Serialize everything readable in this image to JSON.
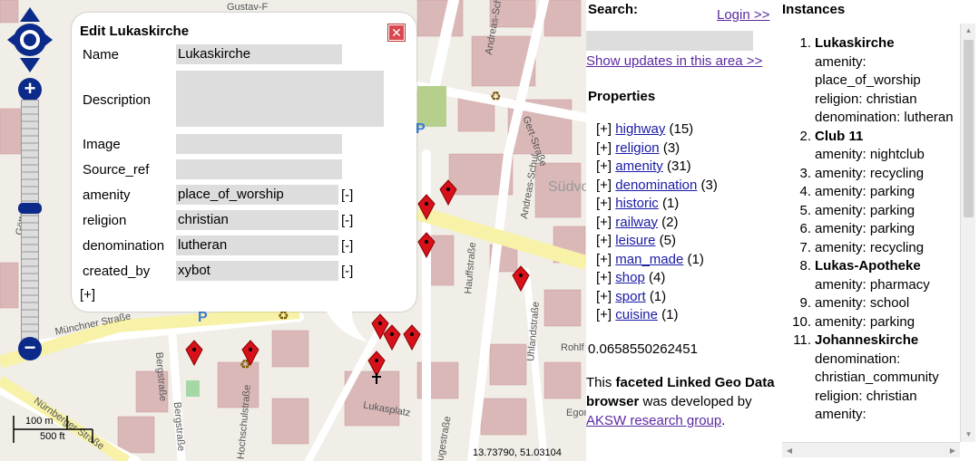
{
  "map": {
    "streets": [
      "Andreas-Schu",
      "Gert-Straße",
      "Andreas-Schul",
      "Südvo",
      "Hauffstraße",
      "Uhlandstraße",
      "Rohlf",
      "Egon",
      "Lukasplatz",
      "Hochschulstraße",
      "Bergstraße",
      "Bergstraße",
      "Münchner Straße",
      "Nürnberger Straße",
      "Göttstraße",
      "Rugestraße",
      "Gustav-F"
    ],
    "poi_parking": "P",
    "scale_metric": "100 m",
    "scale_imperial": "500 ft",
    "coords": "13.73790, 51.03104",
    "colors": {
      "road_yellow": "#f7f2a8",
      "building": "#dab8b8",
      "background": "#f1eee8",
      "pin": "#d6111a",
      "nav_blue": "#0b2a8a"
    }
  },
  "navigation": {
    "zoom_in": "+",
    "zoom_out": "−"
  },
  "popup": {
    "title": "Edit Lukaskirche",
    "close_icon": "close-icon",
    "fields": [
      {
        "label": "Name",
        "value": "Lukaskirche",
        "removable": false
      },
      {
        "label": "Description",
        "value": "",
        "removable": false
      },
      {
        "label": "Image",
        "value": "",
        "removable": false
      },
      {
        "label": "Source_ref",
        "value": "",
        "removable": false
      },
      {
        "label": "amenity",
        "value": "place_of_worship",
        "remove": "[-]"
      },
      {
        "label": "religion",
        "value": "christian",
        "remove": "[-]"
      },
      {
        "label": "denomination",
        "value": "lutheran",
        "remove": "[-]"
      },
      {
        "label": "created_by",
        "value": "xybot",
        "remove": "[-]"
      }
    ],
    "add_label": "[+]"
  },
  "panel": {
    "search_label": "Search:",
    "login_link": "Login >>",
    "search_value": "",
    "updates_link": "Show updates in this area >>",
    "properties_title": "Properties",
    "properties": [
      {
        "expand": "[+]",
        "name": "highway",
        "count": "(15)"
      },
      {
        "expand": "[+]",
        "name": "religion",
        "count": "(3)"
      },
      {
        "expand": "[+]",
        "name": "amenity",
        "count": "(31)"
      },
      {
        "expand": "[+]",
        "name": "denomination",
        "count": "(3)"
      },
      {
        "expand": "[+]",
        "name": "historic",
        "count": "(1)"
      },
      {
        "expand": "[+]",
        "name": "railway",
        "count": "(2)"
      },
      {
        "expand": "[+]",
        "name": "leisure",
        "count": "(5)"
      },
      {
        "expand": "[+]",
        "name": "man_made",
        "count": "(1)"
      },
      {
        "expand": "[+]",
        "name": "shop",
        "count": "(4)"
      },
      {
        "expand": "[+]",
        "name": "sport",
        "count": "(1)"
      },
      {
        "expand": "[+]",
        "name": "cuisine",
        "count": "(1)"
      }
    ],
    "ratio": "0.0658550262451",
    "credits": {
      "pre": "This ",
      "bold": "faceted Linked Geo Data browser",
      "mid": " was developed by ",
      "link": "AKSW research group",
      "post": "."
    }
  },
  "instances": {
    "title": "Instances",
    "items": [
      {
        "num": "1.",
        "name": "Lukaskirche",
        "lines": [
          "amenity: place_of_worship",
          "religion: christian",
          "denomination: lutheran"
        ]
      },
      {
        "num": "2.",
        "name": "Club 11",
        "lines": [
          "amenity: nightclub"
        ]
      },
      {
        "num": "3.",
        "name": "",
        "lines": [
          "amenity: recycling"
        ]
      },
      {
        "num": "4.",
        "name": "",
        "lines": [
          "amenity: parking"
        ]
      },
      {
        "num": "5.",
        "name": "",
        "lines": [
          "amenity: parking"
        ]
      },
      {
        "num": "6.",
        "name": "",
        "lines": [
          "amenity: parking"
        ]
      },
      {
        "num": "7.",
        "name": "",
        "lines": [
          "amenity: recycling"
        ]
      },
      {
        "num": "8.",
        "name": "Lukas-Apotheke",
        "lines": [
          "amenity: pharmacy"
        ]
      },
      {
        "num": "9.",
        "name": "",
        "lines": [
          "amenity: school"
        ]
      },
      {
        "num": "10.",
        "name": "",
        "lines": [
          "amenity: parking"
        ]
      },
      {
        "num": "11.",
        "name": "Johanneskirche",
        "lines": [
          "denomination: christian_community",
          "religion: christian",
          "amenity:"
        ]
      }
    ]
  }
}
